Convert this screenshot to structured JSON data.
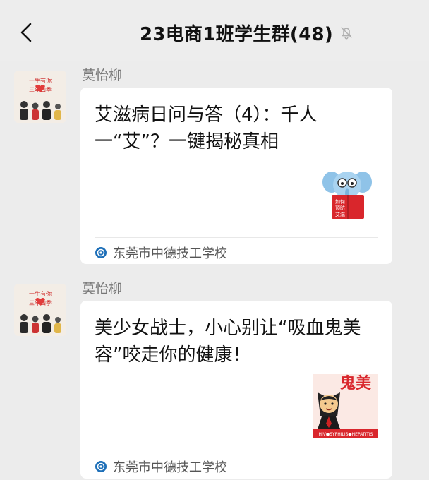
{
  "header": {
    "back_icon": "chevron-left-icon",
    "title": "23电商1班学生群(48)",
    "mute_icon": "bell-off-icon"
  },
  "messages": [
    {
      "sender": "莫怡柳",
      "article_title": "艾滋病日问与答（4）：千人一“艾”？一键揭秘真相",
      "thumb_icon": "elephant-reading-book-icon",
      "thumb_text": [
        "如何",
        "预防",
        "艾滋"
      ],
      "source": "东莞市中德技工学校"
    },
    {
      "sender": "莫怡柳",
      "article_title": "美少女战士，小心别让“吸血鬼美容”咬走你的健康！",
      "thumb_icon": "vampire-emoji-icon",
      "thumb_text": [
        "鬼美",
        "HIV●SYPHILIS●HEPATITIS"
      ],
      "source": "东莞市中德技工学校"
    }
  ],
  "avatar": {
    "icon": "group-avatar-icon",
    "text": [
      "一生有你",
      "三年四季"
    ]
  },
  "colors": {
    "background": "#ececec",
    "card": "#ffffff",
    "source_icon": "#1d6fb8",
    "thumb_red": "#d9262c"
  }
}
